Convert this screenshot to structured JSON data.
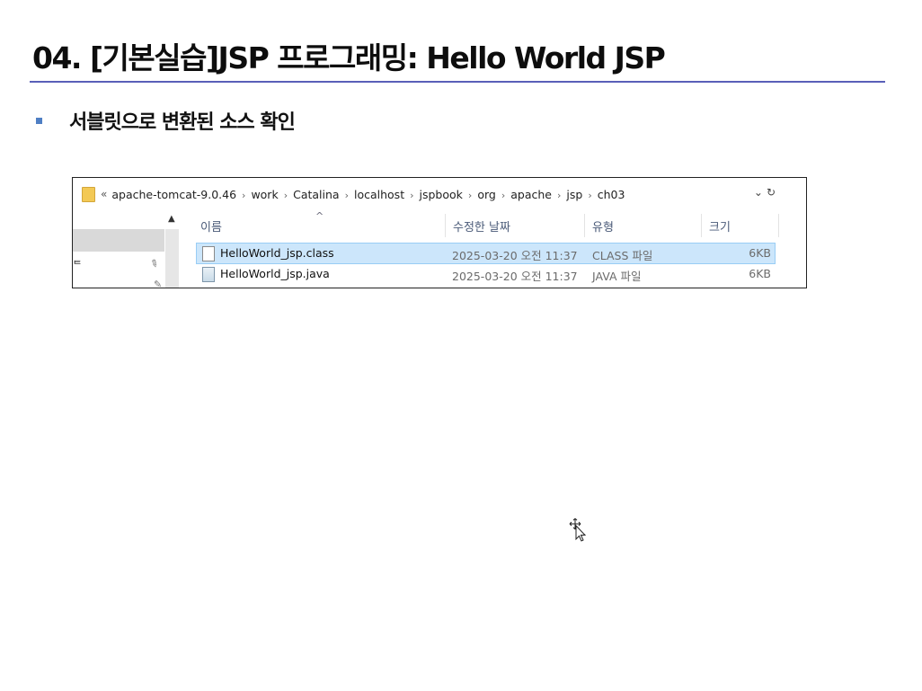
{
  "slide": {
    "title": "04. [기본실습]JSP 프로그래밍: Hello World JSP",
    "bullet": "서블릿으로 변환된 소스 확인"
  },
  "explorer": {
    "breadcrumb_prefix": "«",
    "breadcrumb": [
      "apache-tomcat-9.0.46",
      "work",
      "Catalina",
      "localhost",
      "jspbook",
      "org",
      "apache",
      "jsp",
      "ch03"
    ],
    "breadcrumb_separator": "›",
    "dropdown_glyph": "⌄",
    "refresh_glyph": "↻",
    "columns": {
      "name": "이름",
      "date": "수정한 날짜",
      "type": "유형",
      "size": "크기"
    },
    "files": [
      {
        "name": "HelloWorld_jsp.class",
        "date": "2025-03-20 오전 11:37",
        "type": "CLASS 파일",
        "size": "6KB",
        "selected": true,
        "icon": "class-file-icon"
      },
      {
        "name": "HelloWorld_jsp.java",
        "date": "2025-03-20 오전 11:37",
        "type": "JAVA 파일",
        "size": "6KB",
        "selected": false,
        "icon": "java-file-icon"
      }
    ]
  },
  "colors": {
    "title_rule": "#5a5fb8",
    "bullet": "#4f7fc4",
    "selection": "#cce6fb",
    "folder": "#f3c955"
  }
}
